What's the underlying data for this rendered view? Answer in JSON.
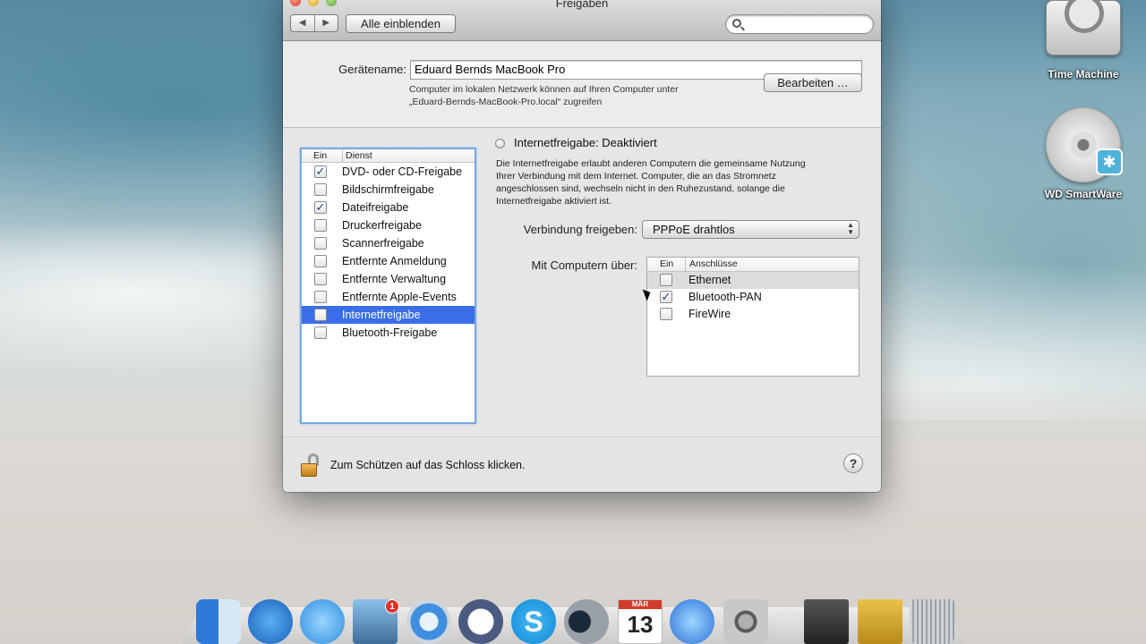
{
  "window": {
    "title": "Freigaben",
    "show_all": "Alle einblenden",
    "nav_back": "◀",
    "nav_forward": "▶",
    "search_placeholder": ""
  },
  "device": {
    "label": "Gerätename:",
    "value": "Eduard Bernds MacBook Pro",
    "info_line1": "Computer im lokalen Netzwerk können auf Ihren Computer unter",
    "info_line2": "„Eduard-Bernds-MacBook-Pro.local“ zugreifen",
    "edit_button": "Bearbeiten …"
  },
  "services": {
    "header_on": "Ein",
    "header_service": "Dienst",
    "items": [
      {
        "label": "DVD- oder CD-Freigabe",
        "checked": true
      },
      {
        "label": "Bildschirmfreigabe",
        "checked": false
      },
      {
        "label": "Dateifreigabe",
        "checked": true
      },
      {
        "label": "Druckerfreigabe",
        "checked": false
      },
      {
        "label": "Scannerfreigabe",
        "checked": false
      },
      {
        "label": "Entfernte Anmeldung",
        "checked": false
      },
      {
        "label": "Entfernte Verwaltung",
        "checked": false
      },
      {
        "label": "Entfernte Apple-Events",
        "checked": false
      },
      {
        "label": "Internetfreigabe",
        "checked": false,
        "selected": true
      },
      {
        "label": "Bluetooth-Freigabe",
        "checked": false
      }
    ]
  },
  "detail": {
    "status": "Internetfreigabe: Deaktiviert",
    "desc1": "Die Internetfreigabe erlaubt anderen Computern die gemeinsame Nutzung",
    "desc2": "Ihrer Verbindung mit dem Internet. Computer, die an das Stromnetz",
    "desc3": "angeschlossen sind, wechseln nicht in den Ruhezustand, solange die",
    "desc4": "Internetfreigabe aktiviert ist.",
    "share_label": "Verbindung freigeben:",
    "share_value": "PPPoE drahtlos",
    "via_label": "Mit Computern über:",
    "ports_header_on": "Ein",
    "ports_header_name": "Anschlüsse",
    "ports": [
      {
        "label": "Ethernet",
        "checked": false
      },
      {
        "label": "Bluetooth-PAN",
        "checked": true
      },
      {
        "label": "FireWire",
        "checked": false
      }
    ]
  },
  "footer": {
    "lock_text": "Zum Schützen auf das Schloss klicken.",
    "help": "?"
  },
  "desktop": {
    "icon1": "Time Machine",
    "icon2": "WD SmartWare"
  },
  "dock": {
    "calendar_month": "MÄR",
    "calendar_day": "13",
    "mail_badge": "1",
    "skype_letter": "S"
  },
  "colors": {
    "selection": "#3a6ee8",
    "focus_ring": "#7aa7e0"
  }
}
